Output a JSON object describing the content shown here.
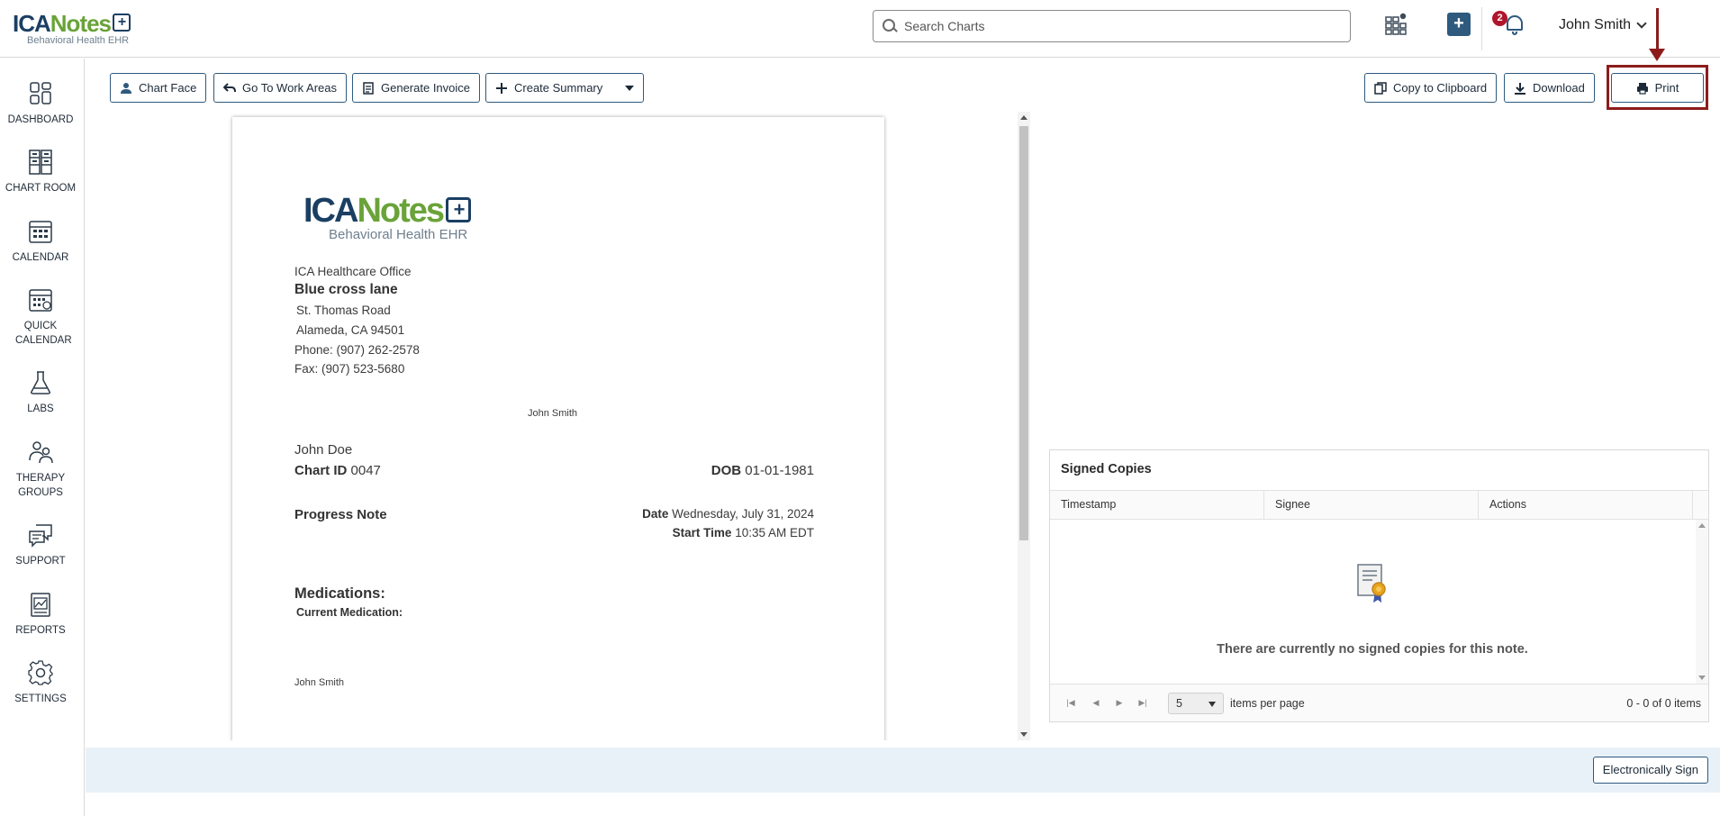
{
  "header": {
    "logo_brand_a": "ICA",
    "logo_brand_b": "Notes",
    "logo_sub": "Behavioral Health EHR",
    "search_placeholder": "Search Charts",
    "notification_count": "2",
    "user_name": "John Smith"
  },
  "sidebar": {
    "items": [
      {
        "label": "DASHBOARD",
        "icon": "dashboard-icon"
      },
      {
        "label": "CHART ROOM",
        "icon": "chart-room-icon"
      },
      {
        "label": "CALENDAR",
        "icon": "calendar-icon"
      },
      {
        "label": "QUICK CALENDAR",
        "icon": "quick-calendar-icon"
      },
      {
        "label": "LABS",
        "icon": "flask-icon"
      },
      {
        "label": "THERAPY GROUPS",
        "icon": "group-icon"
      },
      {
        "label": "SUPPORT",
        "icon": "chat-icon"
      },
      {
        "label": "REPORTS",
        "icon": "reports-icon"
      },
      {
        "label": "SETTINGS",
        "icon": "gear-icon"
      }
    ]
  },
  "toolbar": {
    "chart_face": "Chart Face",
    "go_to_work_areas": "Go To Work Areas",
    "generate_invoice": "Generate Invoice",
    "create_summary": "Create Summary",
    "copy_to_clipboard": "Copy to Clipboard",
    "download": "Download",
    "print": "Print"
  },
  "document": {
    "office": "ICA Healthcare Office",
    "street_name": "Blue cross lane",
    "address1": "St. Thomas Road",
    "address2": "Alameda, CA 94501",
    "phone": "Phone: (907) 262-2578",
    "fax": "Fax: (907) 523-5680",
    "provider": "John Smith",
    "patient": "John Doe",
    "chart_id_label": "Chart ID",
    "chart_id": "0047",
    "dob_label": "DOB",
    "dob": "01-01-1981",
    "note_type": "Progress Note",
    "date_label": "Date",
    "date": "Wednesday, July 31, 2024",
    "start_time_label": "Start Time",
    "start_time": "10:35 AM EDT",
    "medications_heading": "Medications:",
    "current_medication_label": "Current Medication:",
    "signature_name": "John Smith"
  },
  "signed_copies": {
    "title": "Signed Copies",
    "columns": [
      "Timestamp",
      "Signee",
      "Actions"
    ],
    "empty_message": "There are currently no signed copies for this note.",
    "page_size": "5",
    "items_per_page_label": "items per page",
    "pager_info": "0 - 0 of 0 items"
  },
  "footer": {
    "esign_label": "Electronically Sign"
  },
  "colors": {
    "accent": "#2e5a7e",
    "highlight": "#8c1c1c",
    "brand_green": "#6aa339",
    "brand_navy": "#1b3f63"
  }
}
